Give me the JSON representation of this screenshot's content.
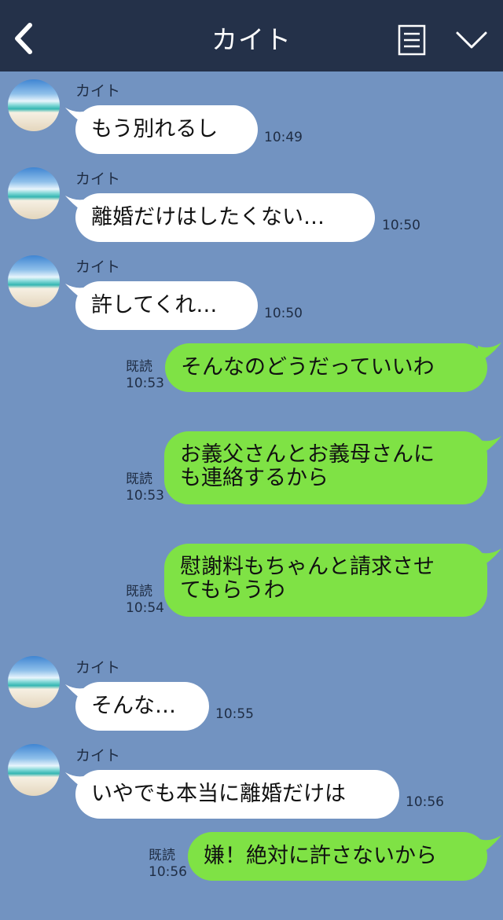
{
  "header": {
    "title": "カイト"
  },
  "colors": {
    "header_bg": "#243149",
    "chat_bg": "#7293c1",
    "outgoing_bubble": "#7fe245",
    "incoming_bubble": "#ffffff"
  },
  "messages": [
    {
      "sender": "カイト",
      "text": "もう別れるし",
      "time": "10:49"
    },
    {
      "sender": "カイト",
      "text": "離婚だけはしたくない…",
      "time": "10:50"
    },
    {
      "sender": "カイト",
      "text": "許してくれ…",
      "time": "10:50"
    },
    {
      "read": "既読",
      "time": "10:53",
      "text": "そんなのどうだっていいわ"
    },
    {
      "read": "既読",
      "time": "10:53",
      "text_line1": "お義父さんとお義母さんに",
      "text_line2": "も連絡するから"
    },
    {
      "read": "既読",
      "time": "10:54",
      "text_line1": "慰謝料もちゃんと請求させ",
      "text_line2": "てもらうわ"
    },
    {
      "sender": "カイト",
      "text": "そんな…",
      "time": "10:55"
    },
    {
      "sender": "カイト",
      "text": "いやでも本当に離婚だけは",
      "time": "10:56"
    },
    {
      "read": "既読",
      "time": "10:56",
      "text": "嫌！絶対に許さないから"
    }
  ]
}
